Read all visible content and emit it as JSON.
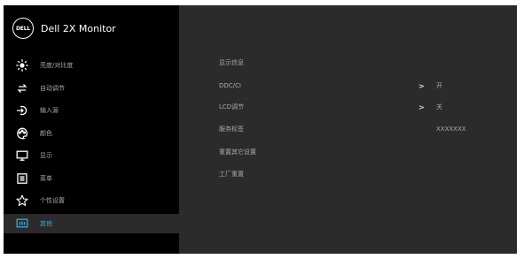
{
  "header": {
    "logo_text": "DELL",
    "title": "Dell 2X Monitor"
  },
  "sidebar": {
    "items": [
      {
        "label": "亮度/对比度",
        "icon": "brightness-icon"
      },
      {
        "label": "自动调节",
        "icon": "auto-adjust-icon"
      },
      {
        "label": "输入源",
        "icon": "input-source-icon"
      },
      {
        "label": "颜色",
        "icon": "color-palette-icon"
      },
      {
        "label": "显示",
        "icon": "display-icon"
      },
      {
        "label": "菜单",
        "icon": "menu-icon"
      },
      {
        "label": "个性设置",
        "icon": "star-icon"
      },
      {
        "label": "其他",
        "icon": "others-icon"
      }
    ],
    "active_index": 7
  },
  "content": {
    "rows": [
      {
        "label": "显示信息",
        "has_arrow": false,
        "value": ""
      },
      {
        "label": "DDC/CI",
        "has_arrow": true,
        "value": "开"
      },
      {
        "label": "LCD调节",
        "has_arrow": true,
        "value": "关"
      },
      {
        "label": "服务标签",
        "has_arrow": false,
        "value": "XXXXXXX"
      },
      {
        "label": "重置其它设置",
        "has_arrow": false,
        "value": ""
      },
      {
        "label": "工厂重置",
        "has_arrow": false,
        "value": ""
      }
    ],
    "arrow_glyph": ">"
  },
  "colors": {
    "background": "#2b2b2b",
    "sidebar": "#000000",
    "accent": "#3ea8dd",
    "text": "#a9a9a9"
  }
}
